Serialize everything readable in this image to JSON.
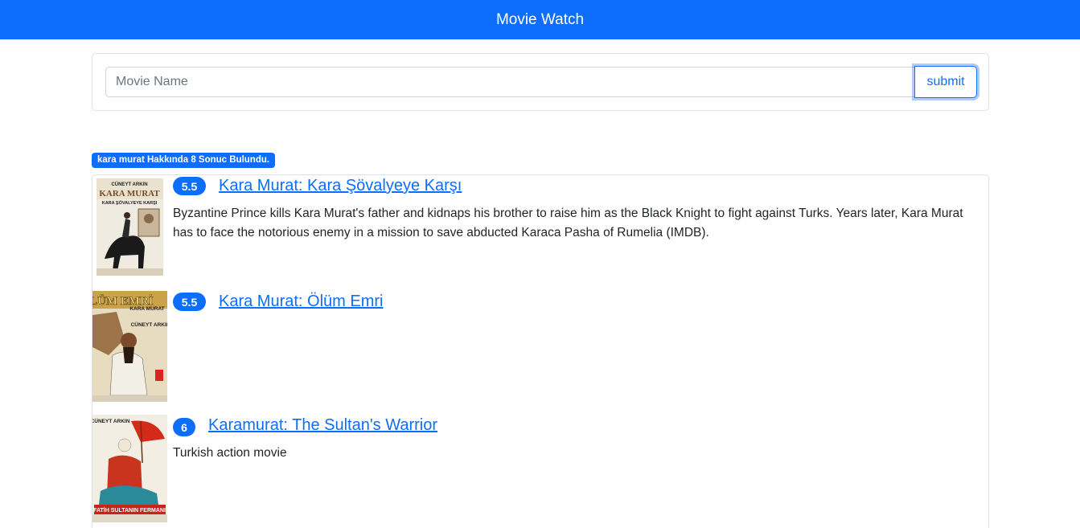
{
  "navbar": {
    "brand": "Movie Watch"
  },
  "search": {
    "placeholder": "Movie Name",
    "value": "",
    "submit_label": "submit"
  },
  "results": {
    "summary": "kara murat Hakkında 8 Sonuc Bulundu."
  },
  "movies": [
    {
      "rating": "5.5",
      "title": "Kara Murat: Kara Şövalyeye Karşı",
      "description": "Byzantine Prince kills Kara Murat's father and kidnaps his brother to raise him as the Black Knight to fight against Turks. Years later, Kara Murat has to face the notorious enemy in a mission to save abducted Karaca Pasha of Rumelia (IMDB).",
      "poster_text": [
        "CÜNEYT ARKIN",
        "KARA MURAT",
        "KARA ŞÖVALYEYE KARŞI"
      ]
    },
    {
      "rating": "5.5",
      "title": "Kara Murat: Ölüm Emri",
      "description": "",
      "poster_text": [
        "ÖLÜM EMRİ",
        "KARA MURAT",
        "CÜNEYT ARKIN"
      ]
    },
    {
      "rating": "6",
      "title": "Karamurat: The Sultan's Warrior",
      "description": "Turkish action movie",
      "poster_text": [
        "CÜNEYT ARKIN",
        "FATİH SULTANIN FERMANI"
      ]
    }
  ],
  "colors": {
    "primary": "#0d6efd",
    "border": "#dee2e6",
    "text": "#212529"
  }
}
